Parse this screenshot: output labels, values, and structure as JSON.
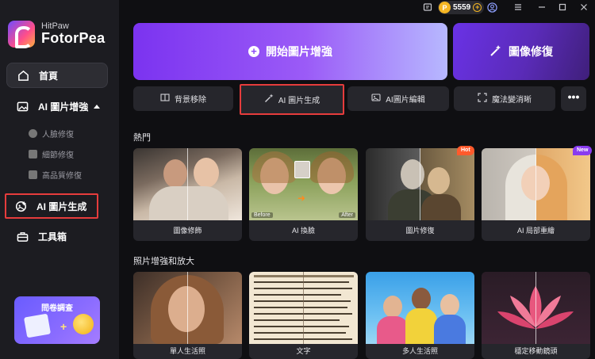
{
  "app": {
    "brand_small": "HitPaw",
    "brand_main": "FotorPea"
  },
  "sidebar": {
    "home": "首頁",
    "ai_enhance": "AI 圖片增強",
    "sub_items": [
      "人臉修復",
      "細節修復",
      "高品質修復"
    ],
    "ai_generate": "AI 圖片生成",
    "toolbox": "工具箱",
    "promo_title": "問卷調查"
  },
  "titlebar": {
    "coins": "5559"
  },
  "banners": {
    "main": "開始圖片增強",
    "repair": "圖像修復"
  },
  "tools": [
    {
      "label": "背景移除",
      "icon": "background-remove-icon"
    },
    {
      "label": "AI 圖片生成",
      "icon": "magic-wand-icon"
    },
    {
      "label": "AI圖片編輯",
      "icon": "image-edit-icon"
    },
    {
      "label": "魔法變消晰",
      "icon": "expand-icon"
    }
  ],
  "more_label": "•••",
  "sections": {
    "hot": {
      "title": "熱門",
      "cards": [
        {
          "label": "圖像修飾",
          "badge": ""
        },
        {
          "label": "AI 換臉",
          "badge": "",
          "before": "Before",
          "after": "After"
        },
        {
          "label": "圖片修復",
          "badge": "Hot"
        },
        {
          "label": "AI 局部重繪",
          "badge": "New"
        }
      ]
    },
    "enhance": {
      "title": "照片增強和放大",
      "cards": [
        {
          "label": "單人生活照"
        },
        {
          "label": "文字"
        },
        {
          "label": "多人生活照"
        },
        {
          "label": "穩定移動鏡頭"
        }
      ]
    }
  },
  "colors": {
    "accent": "#8a48f5",
    "highlight": "#e63c3c",
    "hot": "#ff5a2c",
    "new": "#8a3cf0",
    "coin": "#f5b623"
  }
}
